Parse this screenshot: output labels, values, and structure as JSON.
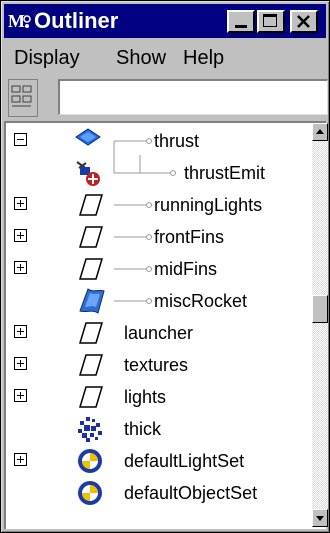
{
  "window": {
    "title": "Outliner",
    "buttons": [
      "minimize",
      "maximize",
      "close"
    ]
  },
  "menu": [
    "Display",
    "Show",
    "Help"
  ],
  "filter": {
    "value": ""
  },
  "tree": [
    {
      "label": "thrust",
      "expander": "minus",
      "icon": "particle-icon",
      "child_of": null
    },
    {
      "label": "thrustEmit",
      "expander": null,
      "icon": "emitter-icon",
      "child_of": "thrust"
    },
    {
      "label": "runningLights",
      "expander": "plus",
      "icon": "transform-icon",
      "child_of": null
    },
    {
      "label": "frontFins",
      "expander": "plus",
      "icon": "transform-icon",
      "child_of": null
    },
    {
      "label": "midFins",
      "expander": "plus",
      "icon": "transform-icon",
      "child_of": null
    },
    {
      "label": "miscRocket",
      "expander": null,
      "icon": "surface-icon",
      "child_of": null
    },
    {
      "label": "launcher",
      "expander": "plus",
      "icon": "transform-icon",
      "child_of": null
    },
    {
      "label": "textures",
      "expander": "plus",
      "icon": "transform-icon",
      "child_of": null
    },
    {
      "label": "lights",
      "expander": "plus",
      "icon": "transform-icon",
      "child_of": null
    },
    {
      "label": "thick",
      "expander": null,
      "icon": "particle-cloud-icon",
      "child_of": null
    },
    {
      "label": "defaultLightSet",
      "expander": "plus",
      "icon": "set-icon",
      "child_of": null
    },
    {
      "label": "defaultObjectSet",
      "expander": null,
      "icon": "set-icon",
      "child_of": null
    }
  ],
  "colors": {
    "titlebar": "#000080",
    "face": "#c0c0c0"
  }
}
